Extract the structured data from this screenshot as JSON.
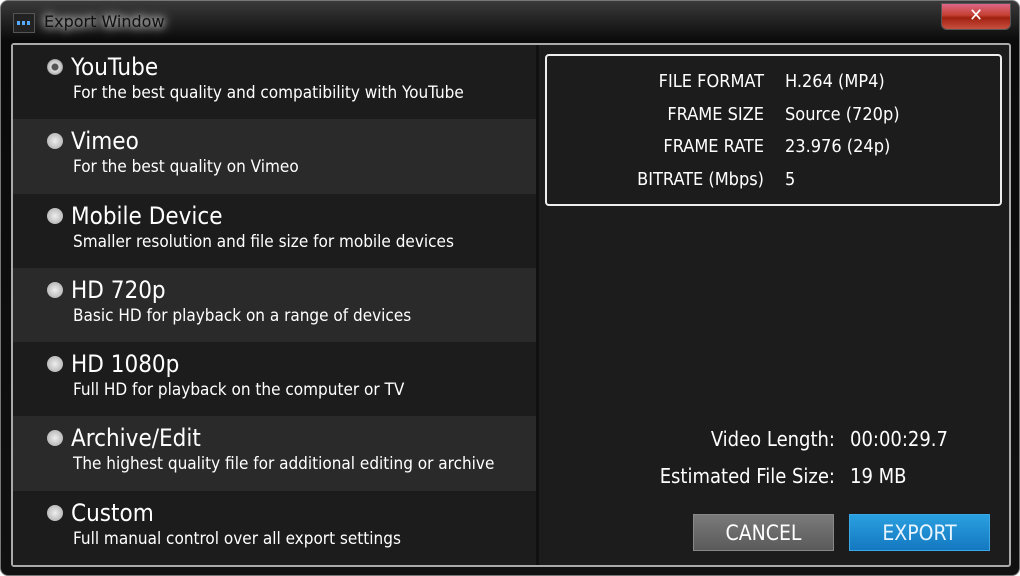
{
  "window": {
    "title": "Export Window",
    "close_label": "✕"
  },
  "presets": [
    {
      "name": "YouTube",
      "description": "For the best quality and compatibility with YouTube",
      "selected": true
    },
    {
      "name": "Vimeo",
      "description": "For the best quality on Vimeo",
      "selected": false
    },
    {
      "name": "Mobile Device",
      "description": "Smaller resolution and file size for mobile devices",
      "selected": false
    },
    {
      "name": "HD 720p",
      "description": "Basic HD for playback on a range of devices",
      "selected": false
    },
    {
      "name": "HD 1080p",
      "description": "Full HD for playback on the computer or TV",
      "selected": false
    },
    {
      "name": "Archive/Edit",
      "description": "The highest quality file for additional editing or archive",
      "selected": false
    },
    {
      "name": "Custom",
      "description": "Full manual control over all export settings",
      "selected": false
    }
  ],
  "settings": [
    {
      "label": "FILE FORMAT",
      "value": "H.264 (MP4)"
    },
    {
      "label": "FRAME SIZE",
      "value": "Source (720p)"
    },
    {
      "label": "FRAME RATE",
      "value": "23.976 (24p)"
    },
    {
      "label": "BITRATE (Mbps)",
      "value": "5"
    }
  ],
  "summary": {
    "length_label": "Video Length:",
    "length_value": "00:00:29.7",
    "size_label": "Estimated File Size:",
    "size_value": "19 MB"
  },
  "buttons": {
    "cancel": "CANCEL",
    "export": "EXPORT"
  },
  "colors": {
    "export": "#1e8fd5",
    "cancel": "#6a6a6a",
    "close": "#c44030"
  }
}
